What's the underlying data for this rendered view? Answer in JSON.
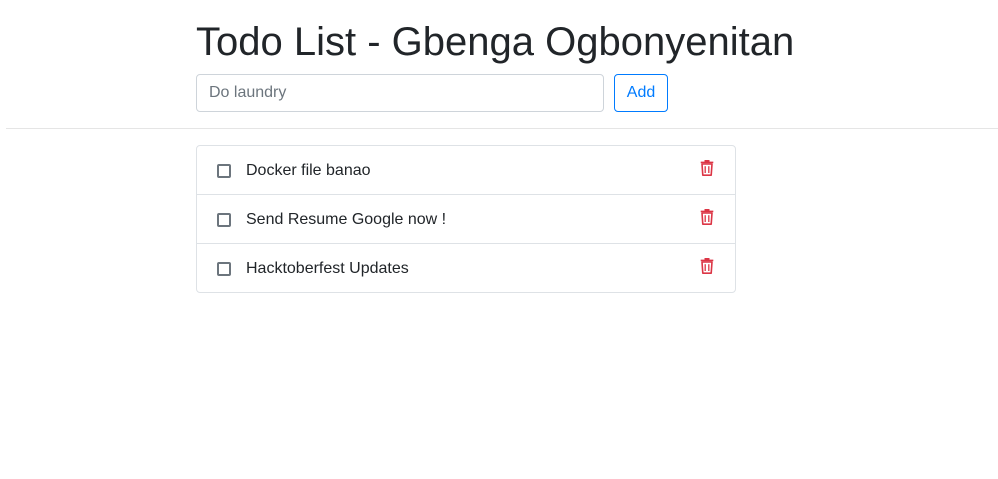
{
  "header": {
    "title": "Todo List - Gbenga Ogbonyenitan"
  },
  "form": {
    "input_placeholder": "Do laundry",
    "input_value": "",
    "add_label": "Add"
  },
  "todos": [
    {
      "text": "Docker file banao",
      "done": false
    },
    {
      "text": "Send Resume Google now !",
      "done": false
    },
    {
      "text": "Hacktoberfest Updates",
      "done": false
    }
  ],
  "icons": {
    "delete": "trash-icon"
  },
  "colors": {
    "accent": "#007bff",
    "danger": "#dc3545",
    "text": "#212529"
  }
}
